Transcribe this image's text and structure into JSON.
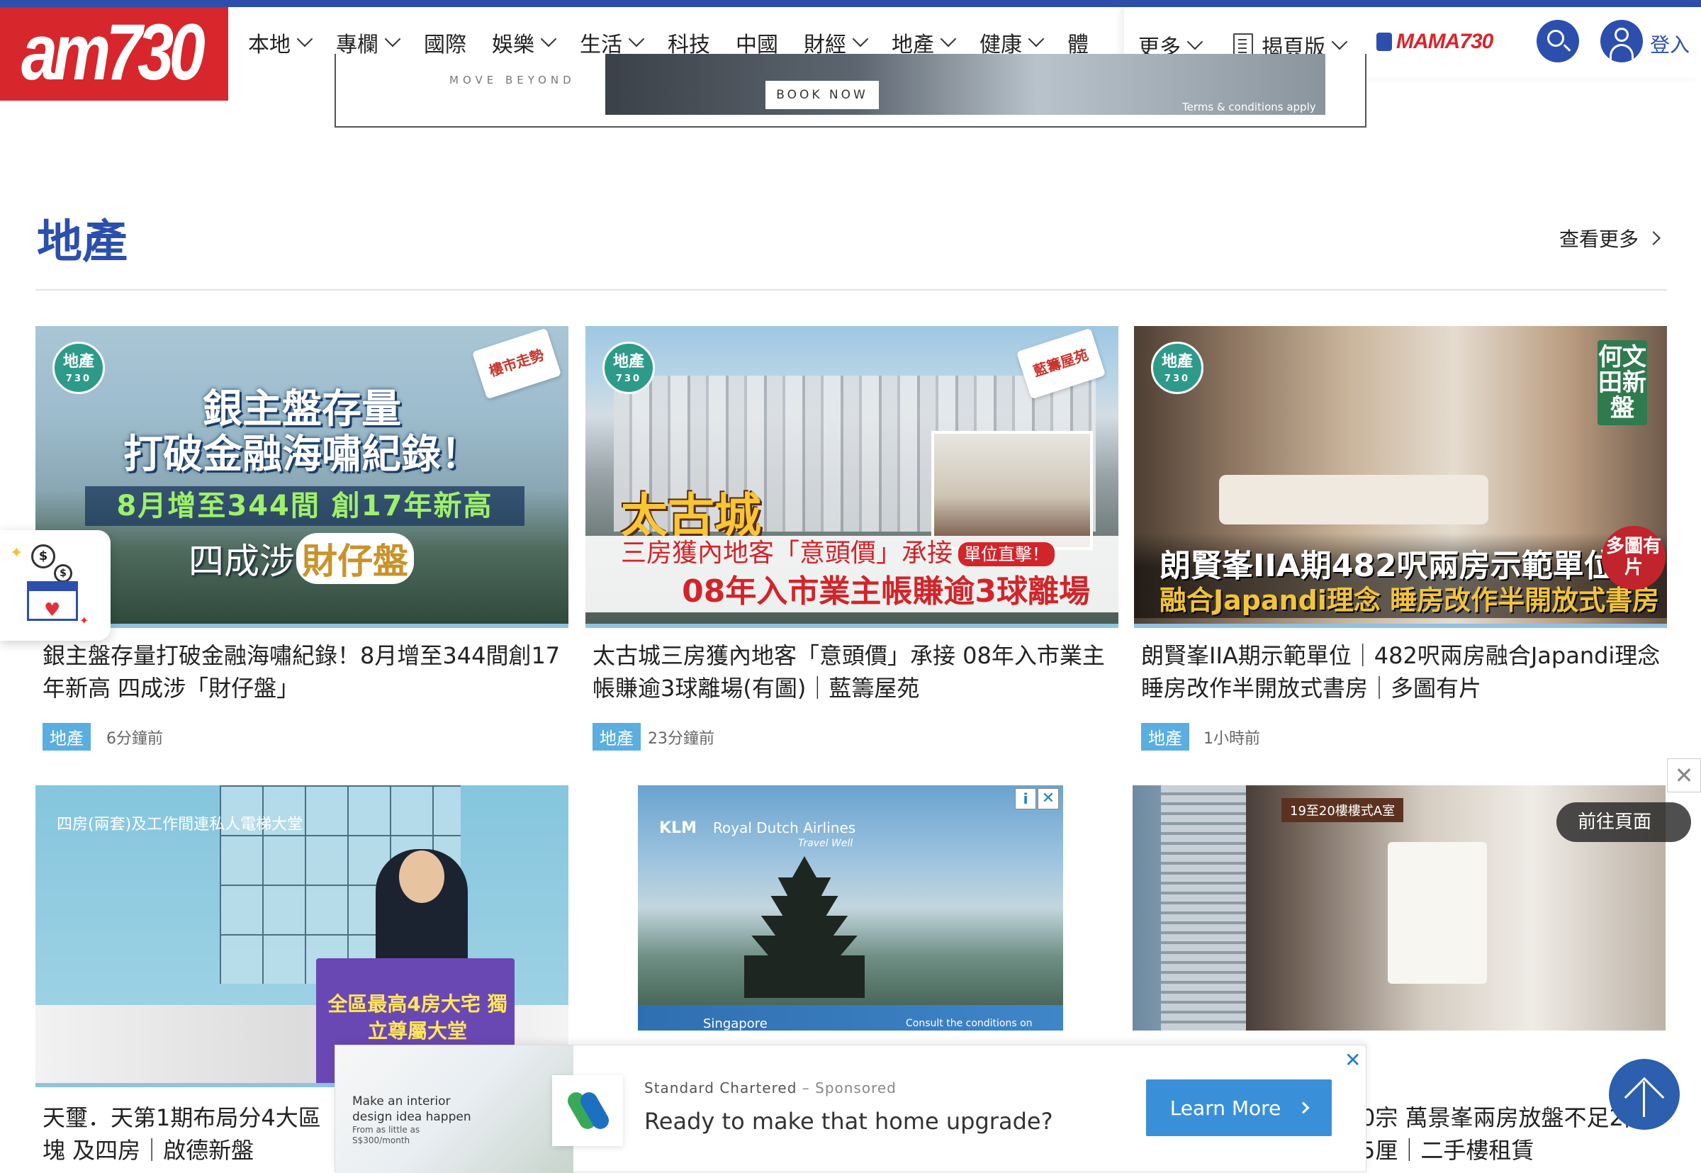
{
  "header": {
    "logo": "am730",
    "nav": [
      {
        "label": "本地",
        "dropdown": true
      },
      {
        "label": "專欄",
        "dropdown": true
      },
      {
        "label": "國際",
        "dropdown": false
      },
      {
        "label": "娛樂",
        "dropdown": true
      },
      {
        "label": "生活",
        "dropdown": true
      },
      {
        "label": "科技",
        "dropdown": false
      },
      {
        "label": "中國",
        "dropdown": false
      },
      {
        "label": "財經",
        "dropdown": true
      },
      {
        "label": "地產",
        "dropdown": true
      },
      {
        "label": "健康",
        "dropdown": true
      },
      {
        "label": "體",
        "dropdown": false
      }
    ],
    "more_label": "更多",
    "epaper_label": "揭頁版",
    "mama_label": "MAMA730",
    "login_label": "登入",
    "colors": {
      "brand_red": "#d7262c",
      "brand_blue": "#2c4fae"
    }
  },
  "top_ad": {
    "tagline": "MOVE BEYOND",
    "button": "BOOK NOW",
    "terms": "Terms & conditions apply"
  },
  "section": {
    "title": "地產",
    "see_more": "查看更多"
  },
  "cards": [
    {
      "title": "銀主盤存量打破金融海嘯紀錄！8月增至344間創17年新高 四成涉「財仔盤」",
      "tag": "地產",
      "time": "6分鐘前",
      "thumb": {
        "badge": "地產",
        "badge_sub": "730",
        "corner": "樓市走勢",
        "headline_1": "銀主盤存量",
        "headline_2": "打破金融海嘯紀錄！",
        "band": "8月增至344間 創17年新高",
        "sub_prefix": "四成涉",
        "sub_hl": "財仔盤"
      }
    },
    {
      "title": "太古城三房獲內地客「意頭價」承接 08年入市業主帳賺逾3球離場(有圖)｜藍籌屋苑",
      "tag": "地產",
      "time": "23分鐘前",
      "thumb": {
        "badge": "地產",
        "badge_sub": "730",
        "corner": "藍籌屋苑",
        "big": "太古城",
        "line1": "三房獲內地客「意頭價」承接",
        "flash": "單位直擊！",
        "line2": "08年入市業主帳賺逾3球離場"
      }
    },
    {
      "title": "朗賢峯IIA期示範單位｜482呎兩房融合Japandi理念 睡房改作半開放式書房｜多圖有片",
      "tag": "地產",
      "time": "1小時前",
      "thumb": {
        "badge": "地產",
        "badge_sub": "730",
        "vertical": "何文田新盤",
        "cap1": "朗賢峯IIA期482呎兩房示範單位",
        "cap2": "融合Japandi理念 睡房改作半開放式書房",
        "multi": "多圖有片"
      }
    }
  ],
  "row2": {
    "left": {
      "title_visible": "天璽．天第1期布局分4大區塊 及四房｜啟德新盤",
      "plan_label": "四房(兩套)及工作間連私人電梯大堂",
      "board": "全區最高4房大宅 獨立尊屬大堂"
    },
    "ad": {
      "brand": "KLM",
      "airline": "Royal Dutch Airlines",
      "slogan": "Travel Well",
      "destination": "Singapore",
      "conditions": "Consult the conditions on",
      "info_icon": "i",
      "close_icon": "✕"
    },
    "right": {
      "label": "19至20樓樓式A室",
      "go_label": "前往頁面",
      "title_visible": "0宗 萬景峯兩房放盤不足2萬 5厘｜二手樓租賃"
    }
  },
  "floating_widget": {
    "coin_symbol": "$",
    "heart": "♥"
  },
  "sponsored": {
    "image_text": "Make an interior design idea happen",
    "image_sub": "From as little as S$300/month",
    "brand": "Standard Chartered",
    "sponsored": "– Sponsored",
    "headline": "Ready to make that home upgrade?",
    "cta": "Learn More",
    "close": "✕"
  },
  "side_close": "✕"
}
